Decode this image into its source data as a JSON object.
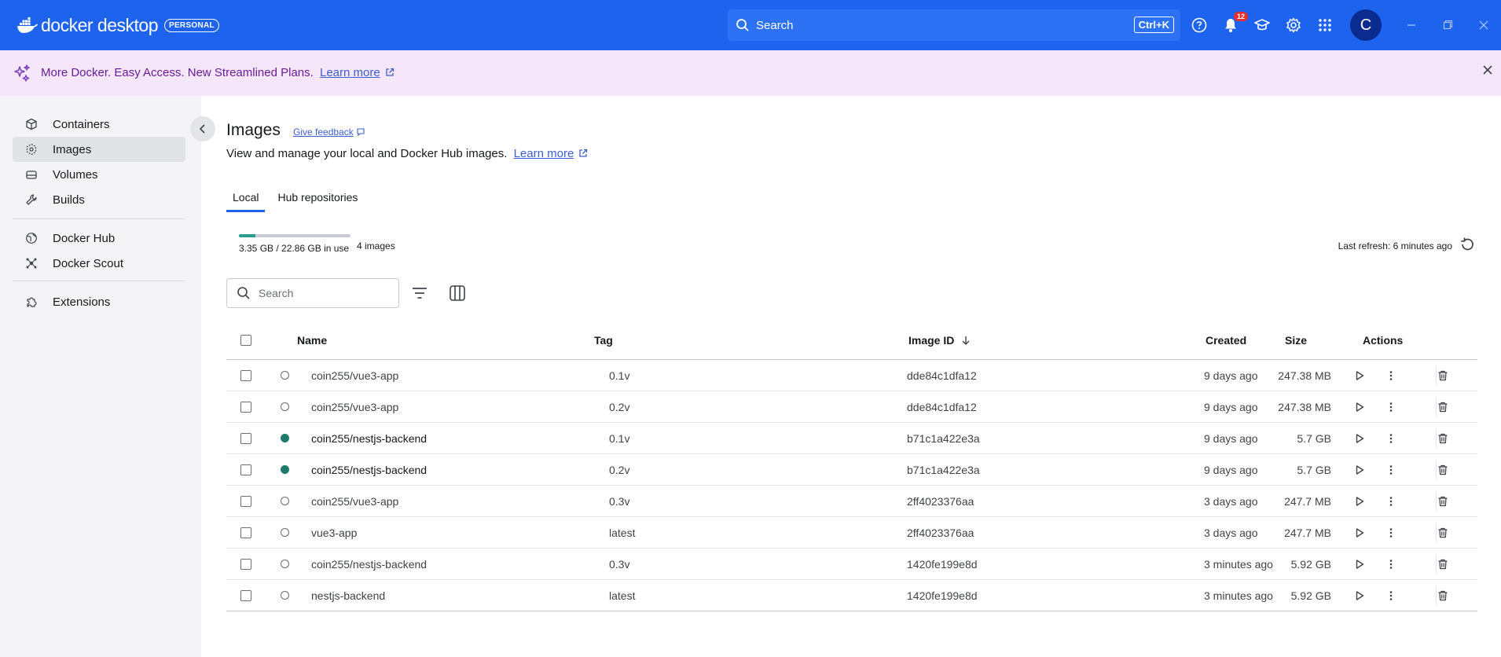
{
  "app": {
    "brand": "docker desktop",
    "plan_badge": "PERSONAL",
    "search_label": "Search",
    "search_shortcut": "Ctrl+K",
    "notification_count": "12",
    "avatar_initial": "C",
    "accent_color": "#1d63ed"
  },
  "promo": {
    "text": "More Docker. Easy Access. New Streamlined Plans.",
    "link": "Learn more"
  },
  "sidebar": {
    "items": [
      {
        "label": "Containers",
        "icon": "cube-icon"
      },
      {
        "label": "Images",
        "icon": "images-icon"
      },
      {
        "label": "Volumes",
        "icon": "volume-icon"
      },
      {
        "label": "Builds",
        "icon": "wrench-icon"
      },
      {
        "label": "Docker Hub",
        "icon": "globe-icon"
      },
      {
        "label": "Docker Scout",
        "icon": "scout-icon"
      },
      {
        "label": "Extensions",
        "icon": "puzzle-icon"
      }
    ]
  },
  "page": {
    "title": "Images",
    "feedback": "Give feedback",
    "subtitle": "View and manage your local and Docker Hub images.",
    "subtitle_link": "Learn more",
    "tabs": [
      "Local",
      "Hub repositories"
    ],
    "usage_text": "3.35 GB / 22.86 GB in use",
    "usage_fraction": 0.147,
    "image_count": "4 images",
    "last_refresh": "Last refresh: 6 minutes ago",
    "search_placeholder": "Search"
  },
  "table": {
    "headers": {
      "name": "Name",
      "tag": "Tag",
      "image_id": "Image ID",
      "created": "Created",
      "size": "Size",
      "actions": "Actions"
    },
    "rows": [
      {
        "name": "coin255/vue3-app",
        "tag": "0.1v",
        "image_id": "dde84c1dfa12",
        "created": "9 days ago",
        "size": "247.38 MB",
        "in_use": false
      },
      {
        "name": "coin255/vue3-app",
        "tag": "0.2v",
        "image_id": "dde84c1dfa12",
        "created": "9 days ago",
        "size": "247.38 MB",
        "in_use": false
      },
      {
        "name": "coin255/nestjs-backend",
        "tag": "0.1v",
        "image_id": "b71c1a422e3a",
        "created": "9 days ago",
        "size": "5.7 GB",
        "in_use": true
      },
      {
        "name": "coin255/nestjs-backend",
        "tag": "0.2v",
        "image_id": "b71c1a422e3a",
        "created": "9 days ago",
        "size": "5.7 GB",
        "in_use": true
      },
      {
        "name": "coin255/vue3-app",
        "tag": "0.3v",
        "image_id": "2ff4023376aa",
        "created": "3 days ago",
        "size": "247.7 MB",
        "in_use": false
      },
      {
        "name": "vue3-app",
        "tag": "latest",
        "image_id": "2ff4023376aa",
        "created": "3 days ago",
        "size": "247.7 MB",
        "in_use": false
      },
      {
        "name": "coin255/nestjs-backend",
        "tag": "0.3v",
        "image_id": "1420fe199e8d",
        "created": "3 minutes ago",
        "size": "5.92 GB",
        "in_use": false
      },
      {
        "name": "nestjs-backend",
        "tag": "latest",
        "image_id": "1420fe199e8d",
        "created": "3 minutes ago",
        "size": "5.92 GB",
        "in_use": false
      }
    ]
  }
}
